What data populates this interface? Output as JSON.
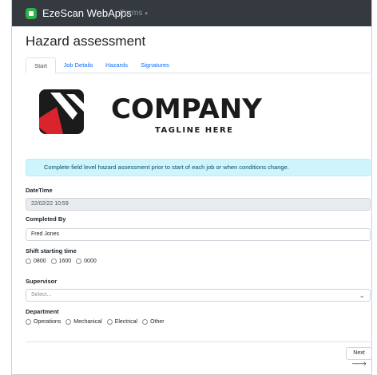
{
  "navbar": {
    "brand": "EzeScan WebApps",
    "forms_label": "Forms",
    "forms_caret": "▾"
  },
  "page": {
    "title": "Hazard assessment"
  },
  "tabs": [
    {
      "label": "Start",
      "active": true
    },
    {
      "label": "Job Details",
      "active": false
    },
    {
      "label": "Hazards",
      "active": false
    },
    {
      "label": "Signatures",
      "active": false
    }
  ],
  "banner": {
    "company": "COMPANY",
    "tagline": "TAGLINE HERE",
    "colors": {
      "dark": "#1b1b1b",
      "accent": "#d9242b"
    }
  },
  "alert": {
    "text": "Complete field level hazard assessment prior to start of each job or when conditions change."
  },
  "form": {
    "datetime": {
      "label": "DateTime",
      "value": "22/02/22 10:59"
    },
    "completed_by": {
      "label": "Completed By",
      "value": "Fred Jones"
    },
    "shift": {
      "label": "Shift starting time",
      "options": [
        "0800",
        "1600",
        "0000"
      ]
    },
    "supervisor": {
      "label": "Supervisor",
      "placeholder": "Select..."
    },
    "department": {
      "label": "Department",
      "options": [
        "Operations",
        "Mechanical",
        "Electrical",
        "Other"
      ]
    }
  },
  "footer": {
    "next_label": "Next",
    "next_arrow": "🡒"
  }
}
